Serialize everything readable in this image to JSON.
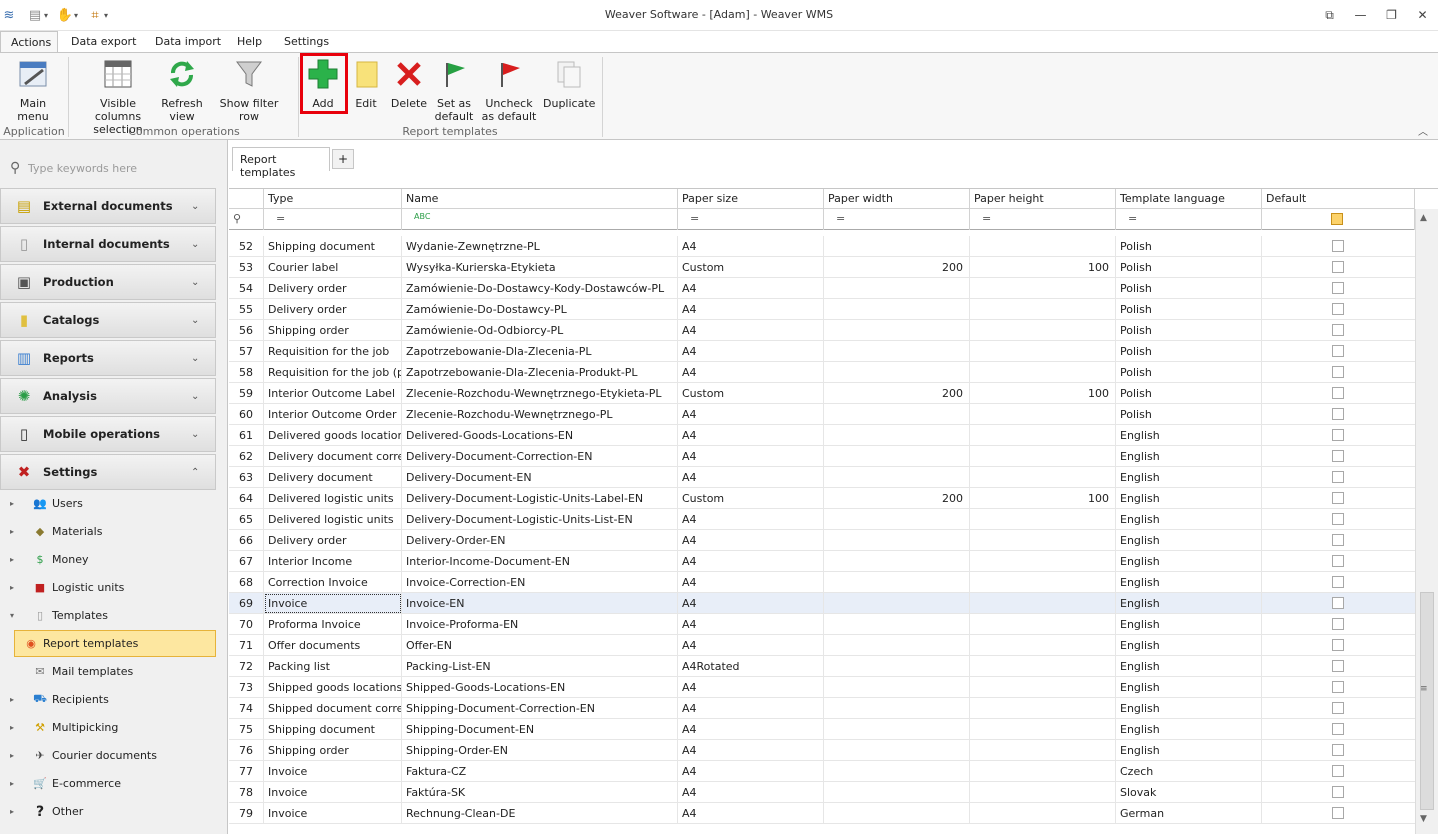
{
  "window": {
    "title": "Weaver Software - [Adam] - Weaver WMS",
    "controls": [
      "⧉",
      "—",
      "❐",
      "✕"
    ]
  },
  "menu_tabs": [
    "Actions",
    "Data export",
    "Data import",
    "Help",
    "Settings"
  ],
  "ribbon": {
    "groups": [
      {
        "label": "Application",
        "buttons": [
          {
            "label": "Main menu"
          }
        ]
      },
      {
        "label": "Common operations",
        "buttons": [
          {
            "label": "Visible columns selection"
          },
          {
            "label": "Refresh view"
          },
          {
            "label": "Show filter row"
          }
        ]
      },
      {
        "label": "Report templates",
        "buttons": [
          {
            "label": "Add"
          },
          {
            "label": "Edit"
          },
          {
            "label": "Delete"
          },
          {
            "label": "Set as default"
          },
          {
            "label": "Uncheck as default"
          },
          {
            "label": "Duplicate"
          }
        ]
      }
    ]
  },
  "sidebar": {
    "search_placeholder": "Type keywords here",
    "groups": [
      "External documents",
      "Internal documents",
      "Production",
      "Catalogs",
      "Reports",
      "Analysis",
      "Mobile operations",
      "Settings"
    ],
    "tree": [
      "Users",
      "Materials",
      "Money",
      "Logistic units",
      "Templates",
      "Report templates",
      "Mail templates",
      "Recipients",
      "Multipicking",
      "Courier documents",
      "E-commerce",
      "Other"
    ]
  },
  "document_tab": {
    "label": "Report templates",
    "plus": "+"
  },
  "grid": {
    "columns": [
      "Type",
      "Name",
      "Paper size",
      "Paper width",
      "Paper height",
      "Template language",
      "Default"
    ],
    "filter_marks": [
      "=",
      "ABC",
      "=",
      "=",
      "=",
      "="
    ],
    "selected_row": 69,
    "rows": [
      {
        "n": "52",
        "type": "Shipping document",
        "name": "Wydanie-Zewnętrzne-PL",
        "size": "A4",
        "w": "",
        "h": "",
        "lang": "Polish"
      },
      {
        "n": "53",
        "type": "Courier label",
        "name": "Wysyłka-Kurierska-Etykieta",
        "size": "Custom",
        "w": "200",
        "h": "100",
        "lang": "Polish"
      },
      {
        "n": "54",
        "type": "Delivery order",
        "name": "Zamówienie-Do-Dostawcy-Kody-Dostawców-PL",
        "size": "A4",
        "w": "",
        "h": "",
        "lang": "Polish"
      },
      {
        "n": "55",
        "type": "Delivery order",
        "name": "Zamówienie-Do-Dostawcy-PL",
        "size": "A4",
        "w": "",
        "h": "",
        "lang": "Polish"
      },
      {
        "n": "56",
        "type": "Shipping order",
        "name": "Zamówienie-Od-Odbiorcy-PL",
        "size": "A4",
        "w": "",
        "h": "",
        "lang": "Polish"
      },
      {
        "n": "57",
        "type": "Requisition for the job",
        "name": "Zapotrzebowanie-Dla-Zlecenia-PL",
        "size": "A4",
        "w": "",
        "h": "",
        "lang": "Polish"
      },
      {
        "n": "58",
        "type": "Requisition for the job (p...",
        "name": "Zapotrzebowanie-Dla-Zlecenia-Produkt-PL",
        "size": "A4",
        "w": "",
        "h": "",
        "lang": "Polish"
      },
      {
        "n": "59",
        "type": "Interior Outcome Label",
        "name": "Zlecenie-Rozchodu-Wewnętrznego-Etykieta-PL",
        "size": "Custom",
        "w": "200",
        "h": "100",
        "lang": "Polish"
      },
      {
        "n": "60",
        "type": "Interior Outcome Order",
        "name": "Zlecenie-Rozchodu-Wewnętrznego-PL",
        "size": "A4",
        "w": "",
        "h": "",
        "lang": "Polish"
      },
      {
        "n": "61",
        "type": "Delivered goods locations",
        "name": "Delivered-Goods-Locations-EN",
        "size": "A4",
        "w": "",
        "h": "",
        "lang": "English"
      },
      {
        "n": "62",
        "type": "Delivery document corre...",
        "name": "Delivery-Document-Correction-EN",
        "size": "A4",
        "w": "",
        "h": "",
        "lang": "English"
      },
      {
        "n": "63",
        "type": "Delivery document",
        "name": "Delivery-Document-EN",
        "size": "A4",
        "w": "",
        "h": "",
        "lang": "English"
      },
      {
        "n": "64",
        "type": "Delivered logistic units",
        "name": "Delivery-Document-Logistic-Units-Label-EN",
        "size": "Custom",
        "w": "200",
        "h": "100",
        "lang": "English"
      },
      {
        "n": "65",
        "type": "Delivered logistic units",
        "name": "Delivery-Document-Logistic-Units-List-EN",
        "size": "A4",
        "w": "",
        "h": "",
        "lang": "English"
      },
      {
        "n": "66",
        "type": "Delivery order",
        "name": "Delivery-Order-EN",
        "size": "A4",
        "w": "",
        "h": "",
        "lang": "English"
      },
      {
        "n": "67",
        "type": "Interior Income",
        "name": "Interior-Income-Document-EN",
        "size": "A4",
        "w": "",
        "h": "",
        "lang": "English"
      },
      {
        "n": "68",
        "type": "Correction Invoice",
        "name": "Invoice-Correction-EN",
        "size": "A4",
        "w": "",
        "h": "",
        "lang": "English"
      },
      {
        "n": "69",
        "type": "Invoice",
        "name": "Invoice-EN",
        "size": "A4",
        "w": "",
        "h": "",
        "lang": "English"
      },
      {
        "n": "70",
        "type": "Proforma Invoice",
        "name": "Invoice-Proforma-EN",
        "size": "A4",
        "w": "",
        "h": "",
        "lang": "English"
      },
      {
        "n": "71",
        "type": "Offer documents",
        "name": "Offer-EN",
        "size": "A4",
        "w": "",
        "h": "",
        "lang": "English"
      },
      {
        "n": "72",
        "type": "Packing list",
        "name": "Packing-List-EN",
        "size": "A4Rotated",
        "w": "",
        "h": "",
        "lang": "English"
      },
      {
        "n": "73",
        "type": "Shipped goods locations",
        "name": "Shipped-Goods-Locations-EN",
        "size": "A4",
        "w": "",
        "h": "",
        "lang": "English"
      },
      {
        "n": "74",
        "type": "Shipped document corre...",
        "name": "Shipping-Document-Correction-EN",
        "size": "A4",
        "w": "",
        "h": "",
        "lang": "English"
      },
      {
        "n": "75",
        "type": "Shipping document",
        "name": "Shipping-Document-EN",
        "size": "A4",
        "w": "",
        "h": "",
        "lang": "English"
      },
      {
        "n": "76",
        "type": "Shipping order",
        "name": "Shipping-Order-EN",
        "size": "A4",
        "w": "",
        "h": "",
        "lang": "English"
      },
      {
        "n": "77",
        "type": "Invoice",
        "name": "Faktura-CZ",
        "size": "A4",
        "w": "",
        "h": "",
        "lang": "Czech"
      },
      {
        "n": "78",
        "type": "Invoice",
        "name": "Faktúra-SK",
        "size": "A4",
        "w": "",
        "h": "",
        "lang": "Slovak"
      },
      {
        "n": "79",
        "type": "Invoice",
        "name": "Rechnung-Clean-DE",
        "size": "A4",
        "w": "",
        "h": "",
        "lang": "German"
      }
    ]
  }
}
